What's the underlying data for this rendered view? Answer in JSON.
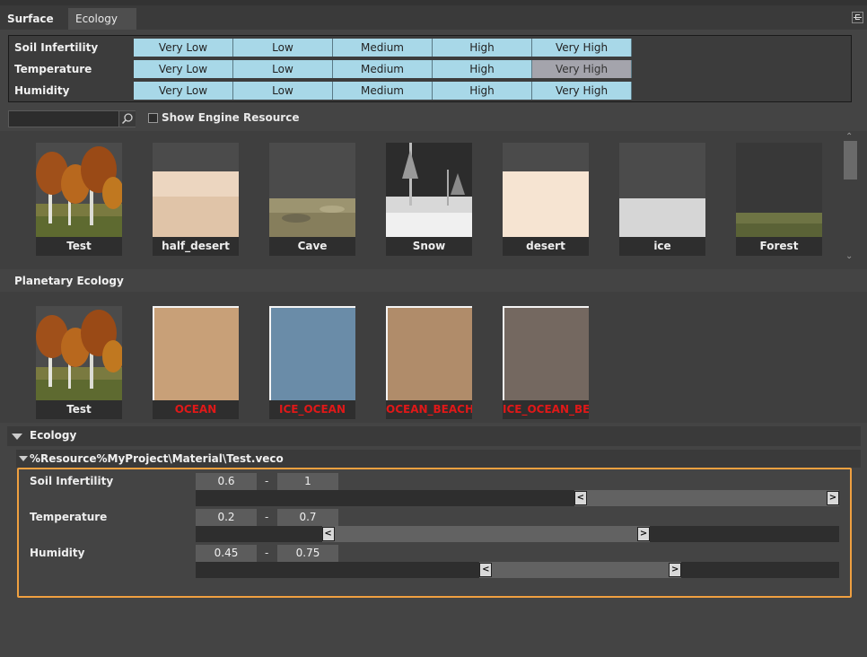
{
  "tabs": [
    {
      "label": "Surface"
    },
    {
      "label": "Ecology"
    }
  ],
  "levels": {
    "rows": [
      {
        "label": "Soil Infertility",
        "selected_index": -1
      },
      {
        "label": "Temperature",
        "selected_index": 4
      },
      {
        "label": "Humidity",
        "selected_index": -1
      }
    ],
    "options": [
      "Very Low",
      "Low",
      "Medium",
      "High",
      "Very High"
    ]
  },
  "search": {
    "placeholder": ""
  },
  "show_engine_resource": {
    "label": "Show Engine Resource",
    "checked": false
  },
  "materials": [
    {
      "label": "Test",
      "icon": "trees-thumbnail"
    },
    {
      "label": "half_desert",
      "icon": "sand-thumbnail"
    },
    {
      "label": "Cave",
      "icon": "rock-thumbnail"
    },
    {
      "label": "Snow",
      "icon": "snow-thumbnail"
    },
    {
      "label": "desert",
      "icon": "desert-thumbnail"
    },
    {
      "label": "ice",
      "icon": "ice-thumbnail"
    },
    {
      "label": "Forest",
      "icon": "forest-thumbnail"
    }
  ],
  "planetary": {
    "title": "Planetary Ecology",
    "items": [
      {
        "label": "Test",
        "color": "",
        "missing": false
      },
      {
        "label": "OCEAN",
        "color": "#c8a078",
        "missing": true
      },
      {
        "label": "ICE_OCEAN",
        "color": "#6a8ca8",
        "missing": true
      },
      {
        "label": "OCEAN_BEACH",
        "color": "#b08c6a",
        "missing": true
      },
      {
        "label": "ICE_OCEAN_BEAC",
        "color": "#746860",
        "missing": true
      }
    ]
  },
  "ecology": {
    "title": "Ecology",
    "path": "%Resource%MyProject\\Material\\Test.veco",
    "ranges": [
      {
        "label": "Soil Infertility",
        "min": "0.6",
        "max": "1",
        "min_value": 0.6,
        "max_value": 1.0
      },
      {
        "label": "Temperature",
        "min": "0.2",
        "max": "0.7",
        "min_value": 0.2,
        "max_value": 0.7
      },
      {
        "label": "Humidity",
        "min": "0.45",
        "max": "0.75",
        "min_value": 0.45,
        "max_value": 0.75
      }
    ],
    "dash": "-",
    "handle_left": "<",
    "handle_right": ">"
  },
  "colors": {
    "accent_highlight": "#f0a040",
    "level_cell": "#a8d8e8",
    "level_selected": "#a4a4ac",
    "missing_label": "#e01818"
  }
}
